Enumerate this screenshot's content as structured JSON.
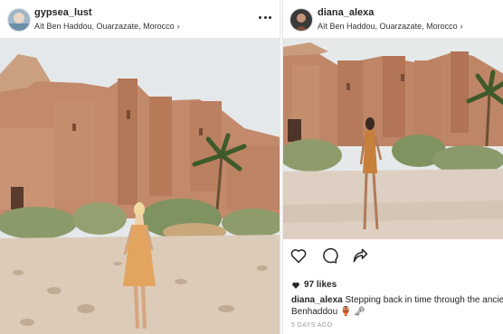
{
  "posts": [
    {
      "username": "gypsea_lust",
      "location": "Aït Ben Haddou, Ouarzazate, Morocco",
      "has_more_menu": true
    },
    {
      "username": "diana_alexa",
      "location": "Aït Ben Haddou, Ouarzazate, Morocco",
      "likes": "97 likes",
      "caption_user": "diana_alexa",
      "caption_text": "Stepping back in time through the ancient city",
      "caption_line2": "Benhaddou 🏺 🗝",
      "date": "5 DAYS AGO",
      "actions": [
        "heart-icon",
        "comment-icon",
        "share-icon"
      ]
    }
  ],
  "colors": {
    "adobe": "#c98e68",
    "sky": "#dfe5e8",
    "ground": "#d9c7b4",
    "dress": "#e0a060"
  }
}
